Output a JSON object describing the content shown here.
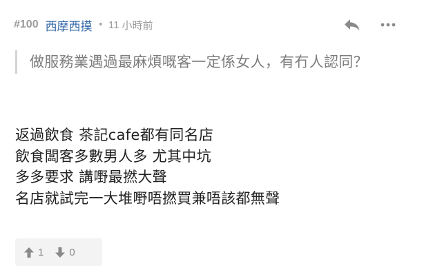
{
  "post": {
    "floor": "#100",
    "username": "西摩西摸",
    "separator": "•",
    "time_value": "11",
    "time_unit": "小時前"
  },
  "actions": {
    "reply_icon": "reply-icon",
    "more_icon": "more-icon"
  },
  "quote": {
    "text": "做服務業遇過最麻煩嘅客一定係女人，有冇人認同？"
  },
  "content": {
    "lines": [
      "返過飲食 茶記cafe都有同名店",
      "飲食闆客多數男人多 尤其中坑",
      "多多要求 講嘢最撚大聲",
      "名店就試完一大堆嘢唔撚買兼唔該都無聲"
    ]
  },
  "votes": {
    "up_icon": "thumb-up-icon",
    "up_count": "1",
    "down_icon": "thumb-down-icon",
    "down_count": "0"
  },
  "colors": {
    "username": "#3468a8",
    "meta": "#9a9a9a",
    "quote_text": "#7d7d7d",
    "quote_border": "#d4d4d4",
    "body_text": "#222222",
    "vote_bg": "#f3f3f3",
    "icon": "#8a8a8a"
  }
}
